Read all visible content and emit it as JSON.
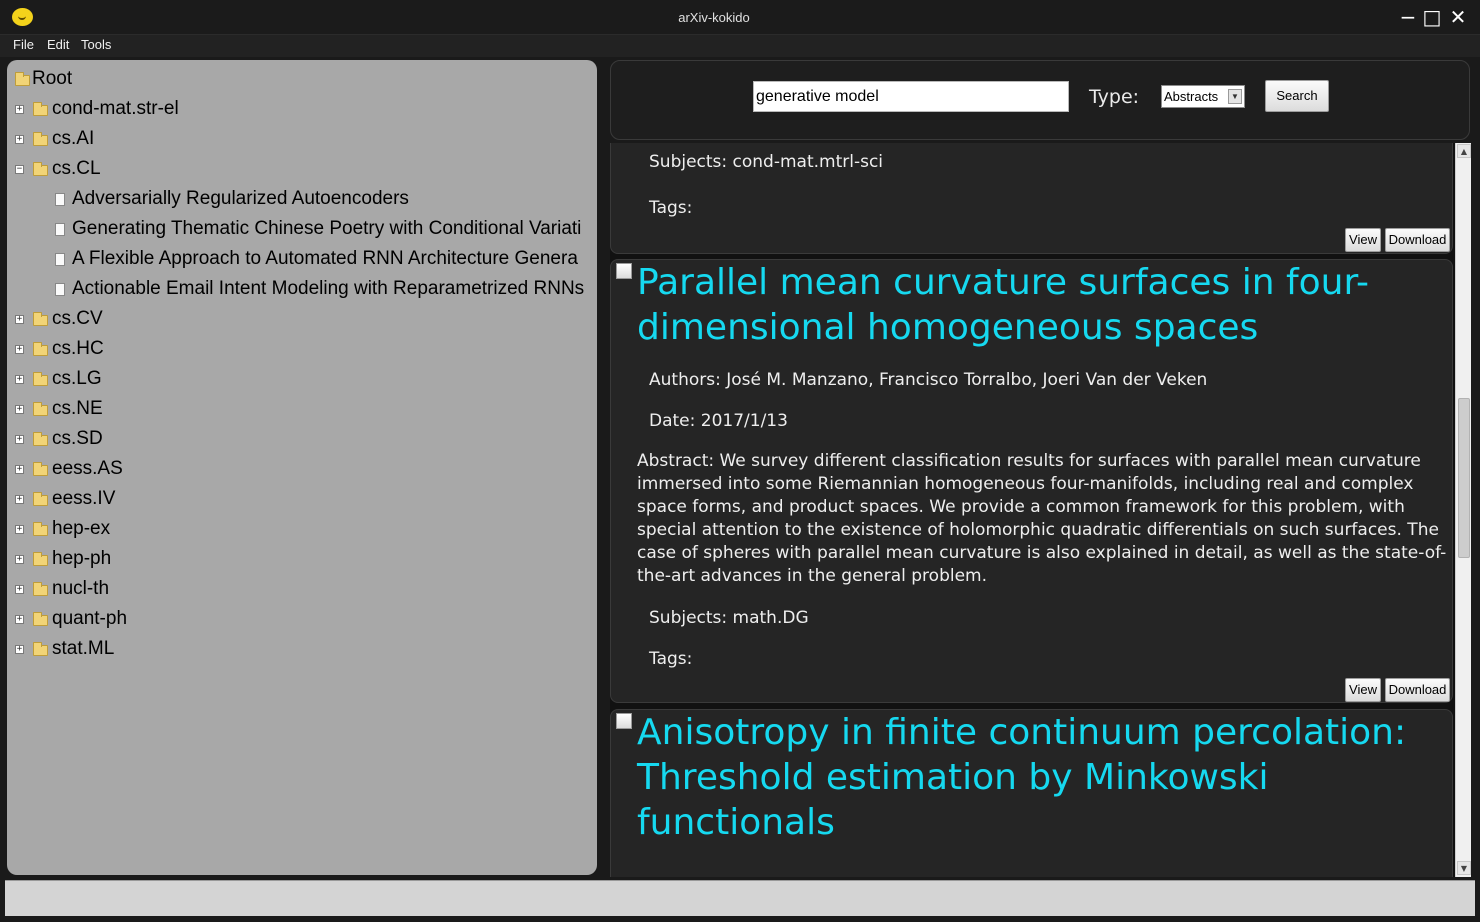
{
  "window": {
    "title": "arXiv-kokido",
    "icon": "kokido-app-icon",
    "controls": {
      "minimize": "−",
      "maximize": "□",
      "close": "✕"
    }
  },
  "menu": [
    "File",
    "Edit",
    "Tools"
  ],
  "tree": {
    "root": "Root",
    "categories": [
      "cond-mat.str-el",
      "cs.AI",
      "cs.CL",
      "cs.CV",
      "cs.HC",
      "cs.LG",
      "cs.NE",
      "cs.SD",
      "eess.AS",
      "eess.IV",
      "hep-ex",
      "hep-ph",
      "nucl-th",
      "quant-ph",
      "stat.ML"
    ],
    "expanded_category": "cs.CL",
    "papers": [
      "Adversarially Regularized Autoencoders",
      "Generating Thematic Chinese Poetry with Conditional Variati",
      "A Flexible Approach to Automated RNN Architecture Genera",
      "Actionable Email Intent Modeling with Reparametrized RNNs"
    ]
  },
  "search": {
    "query": "generative model",
    "type_label": "Type:",
    "type_value": "Abstracts",
    "button": "Search"
  },
  "results": {
    "partial": {
      "subjects": "Subjects: cond-mat.mtrl-sci",
      "tags": "Tags:",
      "view": "View",
      "download": "Download"
    },
    "paper1": {
      "title": "  Parallel mean curvature surfaces in four-dimensional homogeneous spaces",
      "authors": "Authors: José M. Manzano, Francisco Torralbo, Joeri Van der Veken",
      "date": "Date: 2017/1/13",
      "abstract": "  Abstract: We survey different classification results for surfaces with parallel mean curvature immersed into some Riemannian homogeneous four-manifolds, including real and complex space forms, and product spaces. We provide a common framework for this problem, with special attention to the existence of holomorphic quadratic differentials on such surfaces. The case of spheres with parallel mean curvature is also explained in detail, as well as the state-of-the-art advances in the general problem.",
      "subjects": "Subjects: math.DG",
      "tags": "Tags:",
      "view": "View",
      "download": "Download"
    },
    "paper2": {
      "title": "  Anisotropy in finite continuum percolation: Threshold estimation by Minkowski functionals"
    }
  }
}
